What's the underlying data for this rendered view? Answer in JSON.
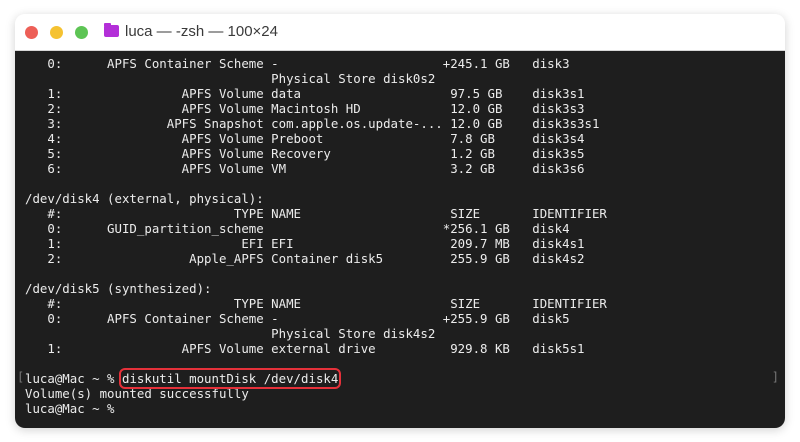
{
  "window": {
    "title": "luca — -zsh — 100×24"
  },
  "disk3_rows": [
    {
      "num": "0:",
      "type": "APFS Container Scheme",
      "name": "-",
      "prefix": "+",
      "size": "245.1 GB",
      "id": "disk3",
      "cont": "Physical Store disk0s2"
    },
    {
      "num": "1:",
      "type": "APFS Volume",
      "name": "data",
      "prefix": " ",
      "size": "97.5 GB",
      "id": "disk3s1"
    },
    {
      "num": "2:",
      "type": "APFS Volume",
      "name": "Macintosh HD",
      "prefix": " ",
      "size": "12.0 GB",
      "id": "disk3s3"
    },
    {
      "num": "3:",
      "type": "APFS Snapshot",
      "name": "com.apple.os.update-...",
      "prefix": " ",
      "size": "12.0 GB",
      "id": "disk3s3s1"
    },
    {
      "num": "4:",
      "type": "APFS Volume",
      "name": "Preboot",
      "prefix": " ",
      "size": "7.8 GB",
      "id": "disk3s4"
    },
    {
      "num": "5:",
      "type": "APFS Volume",
      "name": "Recovery",
      "prefix": " ",
      "size": "1.2 GB",
      "id": "disk3s5"
    },
    {
      "num": "6:",
      "type": "APFS Volume",
      "name": "VM",
      "prefix": " ",
      "size": "3.2 GB",
      "id": "disk3s6"
    }
  ],
  "header": {
    "num": "#:",
    "type": "TYPE",
    "name": "NAME",
    "prefix": " ",
    "size": "SIZE",
    "id": "IDENTIFIER"
  },
  "disk4": {
    "title": "/dev/disk4 (external, physical):",
    "rows": [
      {
        "num": "0:",
        "type": "GUID_partition_scheme",
        "name": "",
        "prefix": "*",
        "size": "256.1 GB",
        "id": "disk4"
      },
      {
        "num": "1:",
        "type": "EFI",
        "name": "EFI",
        "prefix": " ",
        "size": "209.7 MB",
        "id": "disk4s1"
      },
      {
        "num": "2:",
        "type": "Apple_APFS",
        "name": "Container disk5",
        "prefix": " ",
        "size": "255.9 GB",
        "id": "disk4s2"
      }
    ]
  },
  "disk5": {
    "title": "/dev/disk5 (synthesized):",
    "rows": [
      {
        "num": "0:",
        "type": "APFS Container Scheme",
        "name": "-",
        "prefix": "+",
        "size": "255.9 GB",
        "id": "disk5",
        "cont": "Physical Store disk4s2"
      },
      {
        "num": "1:",
        "type": "APFS Volume",
        "name": "external drive",
        "prefix": " ",
        "size": "929.8 KB",
        "id": "disk5s1"
      }
    ]
  },
  "prompt": "luca@Mac ~ % ",
  "command": "diskutil mountDisk /dev/disk4",
  "output": "Volume(s) mounted successfully",
  "final_prompt": "luca@Mac ~ %",
  "colors": {
    "highlight": "#e5313a",
    "terminal_bg": "#1e1e1e"
  }
}
